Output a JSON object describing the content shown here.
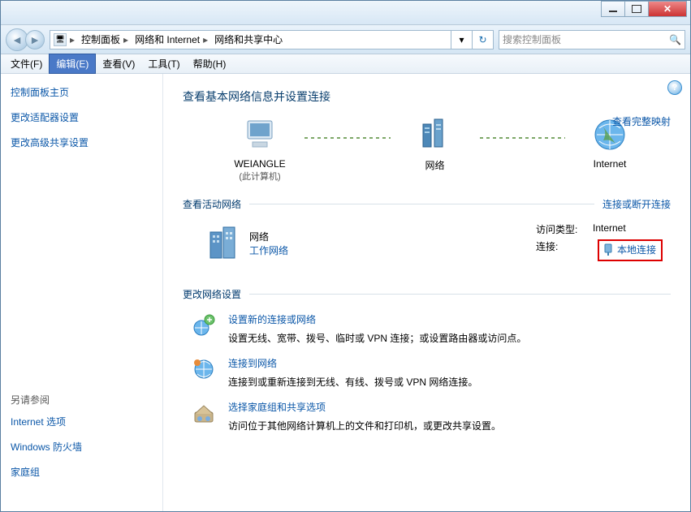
{
  "titlebar": {},
  "breadcrumb": {
    "root_icon": "pc",
    "seg1": "控制面板",
    "seg2": "网络和 Internet",
    "seg3": "网络和共享中心"
  },
  "search": {
    "placeholder": "搜索控制面板"
  },
  "menu": {
    "file": "文件(F)",
    "edit": "编辑(E)",
    "view": "查看(V)",
    "tools": "工具(T)",
    "help": "帮助(H)"
  },
  "sidebar": {
    "home": "控制面板主页",
    "adapter": "更改适配器设置",
    "advanced": "更改高级共享设置",
    "see_also": "另请参阅",
    "see1": "Internet 选项",
    "see2": "Windows 防火墙",
    "see3": "家庭组"
  },
  "main": {
    "title": "查看基本网络信息并设置连接",
    "map_link": "查看完整映射",
    "map": {
      "node1": "WEIANGLE",
      "node1_sub": "(此计算机)",
      "node2": "网络",
      "node3": "Internet"
    },
    "active_section": "查看活动网络",
    "active_link": "连接或断开连接",
    "active": {
      "name": "网络",
      "type": "工作网络",
      "access_k": "访问类型:",
      "access_v": "Internet",
      "conn_k": "连接:",
      "conn_v": "本地连接"
    },
    "change_section": "更改网络设置",
    "tasks": [
      {
        "title": "设置新的连接或网络",
        "desc": "设置无线、宽带、拨号、临时或 VPN 连接；或设置路由器或访问点。"
      },
      {
        "title": "连接到网络",
        "desc": "连接到或重新连接到无线、有线、拨号或 VPN 网络连接。"
      },
      {
        "title": "选择家庭组和共享选项",
        "desc": "访问位于其他网络计算机上的文件和打印机，或更改共享设置。"
      }
    ]
  }
}
